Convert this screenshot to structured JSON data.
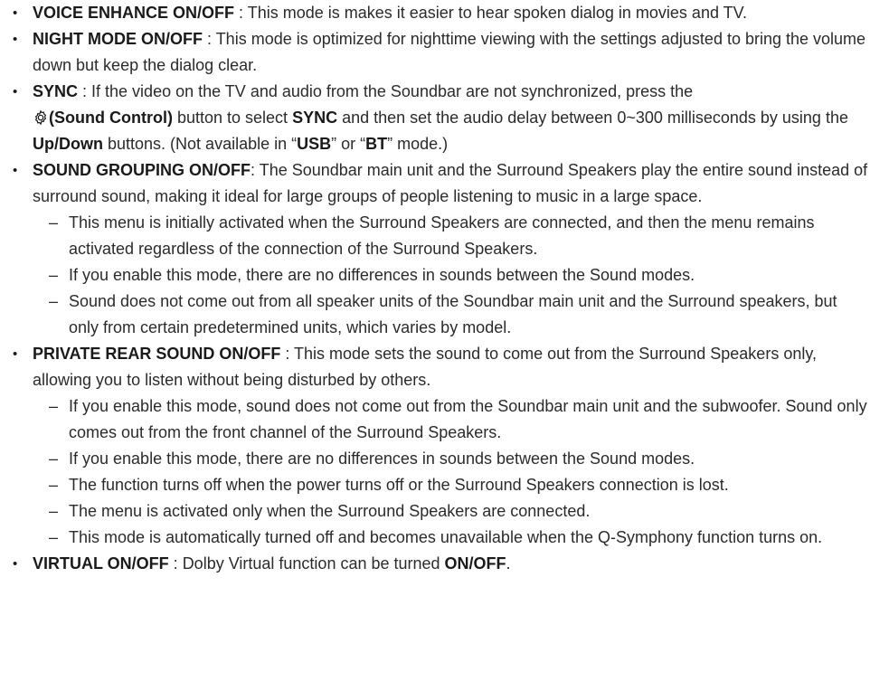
{
  "items": [
    {
      "title": "VOICE ENHANCE ON/OFF",
      "sep": " : ",
      "desc": "This mode is makes it easier to hear spoken dialog in movies and TV."
    },
    {
      "title": "NIGHT MODE ON/OFF",
      "sep": " : ",
      "desc": "This mode is optimized for nighttime viewing with the settings adjusted to bring the volume down but keep the dialog clear."
    },
    {
      "title": "SYNC",
      "sep": " : ",
      "p1": "If the video on the TV and audio from the Soundbar are not synchronized, press the ",
      "icon": "gear-icon",
      "p2": "(Sound Control)",
      "p3": " button to select ",
      "p4": "SYNC",
      "p5": " and then set the audio delay between 0~300 milliseconds by using the ",
      "p6": "Up/Down",
      "p7": " buttons. (Not available in “",
      "p8": "USB",
      "p9": "” or “",
      "p10": "BT",
      "p11": "” mode.)"
    },
    {
      "title": "SOUND GROUPING ON/OFF",
      "sep": ": ",
      "desc": "The Soundbar main unit and the Surround Speakers play the entire sound instead of surround sound, making it ideal for large groups of people listening to music in a large space.",
      "sub": [
        "This menu is initially activated when the Surround Speakers are connected, and then the menu remains activated regardless of the connection of the Surround Speakers.",
        "If you enable this mode, there are no differences in sounds between the Sound modes.",
        "Sound does not come out from all speaker units of the Soundbar main unit and the Surround speakers, but only from certain predetermined units, which varies by model."
      ]
    },
    {
      "title": "PRIVATE REAR SOUND ON/OFF",
      "sep": " : ",
      "desc": "This mode sets the sound to come out from the Surround Speakers only, allowing you to listen without being disturbed by others.",
      "sub": [
        "If you enable this mode, sound does not come out from the Soundbar main unit and the subwoofer. Sound only comes out from the front channel of the Surround Speakers.",
        "If you enable this mode, there are no differences in sounds between the Sound modes.",
        "The function turns off when the power turns off or the Surround Speakers connection is lost.",
        "The menu is activated only when the Surround Speakers are connected.",
        "This mode is automatically turned off and becomes unavailable when the Q-Symphony function turns on."
      ]
    },
    {
      "title": "VIRTUAL ON/OFF",
      "sep": " : ",
      "p1": "Dolby Virtual function can be turned ",
      "p2": "ON/OFF",
      "p3": "."
    }
  ],
  "bullet": "•",
  "dash": "–"
}
